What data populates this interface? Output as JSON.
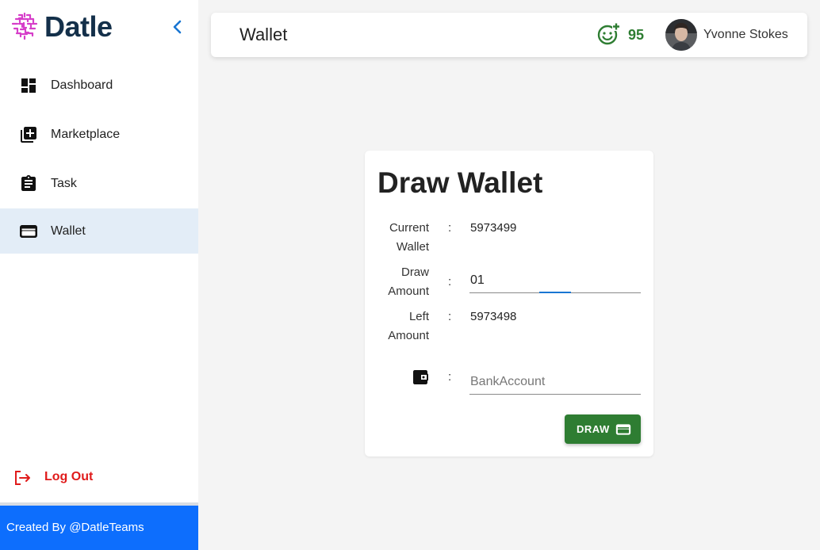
{
  "brand": {
    "name": "Datle",
    "logo_color": "#d63ec9",
    "text_color": "#14304a"
  },
  "sidebar": {
    "collapse_icon": "chevron-left-icon",
    "items": [
      {
        "label": "Dashboard",
        "icon": "dashboard-icon",
        "active": false
      },
      {
        "label": "Marketplace",
        "icon": "library-add-icon",
        "active": false
      },
      {
        "label": "Task",
        "icon": "clipboard-icon",
        "active": false
      },
      {
        "label": "Wallet",
        "icon": "wallet-icon",
        "active": true
      }
    ],
    "logout_label": "Log Out",
    "footer_text": "Created By @DatleTeams",
    "active_bg": "#e3edf7",
    "footer_bg": "#0d6efd",
    "logout_color": "#e01b1b"
  },
  "header": {
    "title": "Wallet",
    "score": "95",
    "score_color": "#2e7d32",
    "user_name": "Yvonne Stokes"
  },
  "card": {
    "title": "Draw Wallet",
    "current_wallet": {
      "label_line1": "Current",
      "label_line2": "Wallet",
      "value": "5973499"
    },
    "draw_amount": {
      "label_line1": "Draw",
      "label_line2": "Amount",
      "value": "01"
    },
    "left_amount": {
      "label_line1": "Left",
      "label_line2": "Amount",
      "value": "5973498"
    },
    "bank_account": {
      "placeholder": "BankAccount",
      "value": ""
    },
    "colon": ":",
    "draw_button_label": "DRAW",
    "button_color": "#2e7d32"
  }
}
